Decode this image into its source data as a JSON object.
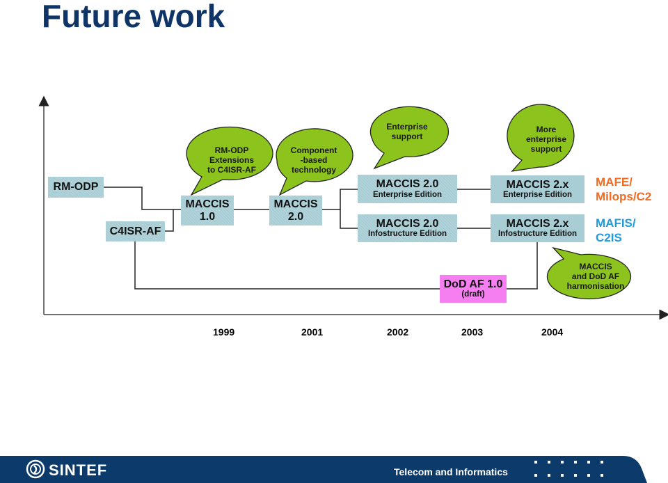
{
  "title": "Future work",
  "colors": {
    "title": "#0f3466",
    "box": "#a8cdd4",
    "bubble": "#8cc31d",
    "pink_box": "#f57ef0",
    "orange_label": "#f26b21",
    "blue_label": "#1e9ae0",
    "footer": "#0b3a6b"
  },
  "boxes": {
    "rm_odp": "RM-ODP",
    "c4isr_af": "C4ISR-AF",
    "maccis_10": {
      "line1": "MACCIS",
      "line2": "1.0"
    },
    "maccis_20": {
      "line1": "MACCIS",
      "line2": "2.0"
    },
    "maccis_20_ee": {
      "line1": "MACCIS 2.0",
      "line2": "Enterprise Edition"
    },
    "maccis_20_ie": {
      "line1": "MACCIS 2.0",
      "line2": "Infostructure Edition"
    },
    "maccis_2x_ee": {
      "line1": "MACCIS 2.x",
      "line2": "Enterprise Edition"
    },
    "maccis_2x_ie": {
      "line1": "MACCIS 2.x",
      "line2": "Infostructure Edition"
    },
    "dod_af": {
      "line1": "DoD AF 1.0",
      "line2": "(draft)"
    }
  },
  "bubbles": {
    "rm_odp_ext": [
      "RM-ODP",
      "Extensions",
      "to C4ISR-AF"
    ],
    "component": [
      "Component",
      "-based",
      "technology"
    ],
    "enterprise": [
      "Enterprise",
      "support"
    ],
    "more_enterprise": [
      "More",
      "enterprise",
      "support"
    ],
    "harmonisation": [
      "MACCIS",
      "and DoD AF",
      "harmonisation"
    ]
  },
  "side_labels": {
    "mafe": [
      "MAFE/",
      "Milops/C2"
    ],
    "mafis": [
      "MAFIS/",
      "C2IS"
    ]
  },
  "years": [
    "1999",
    "2001",
    "2002",
    "2003",
    "2004"
  ],
  "footer": {
    "brand": "SINTEF",
    "department": "Telecom and Informatics"
  }
}
